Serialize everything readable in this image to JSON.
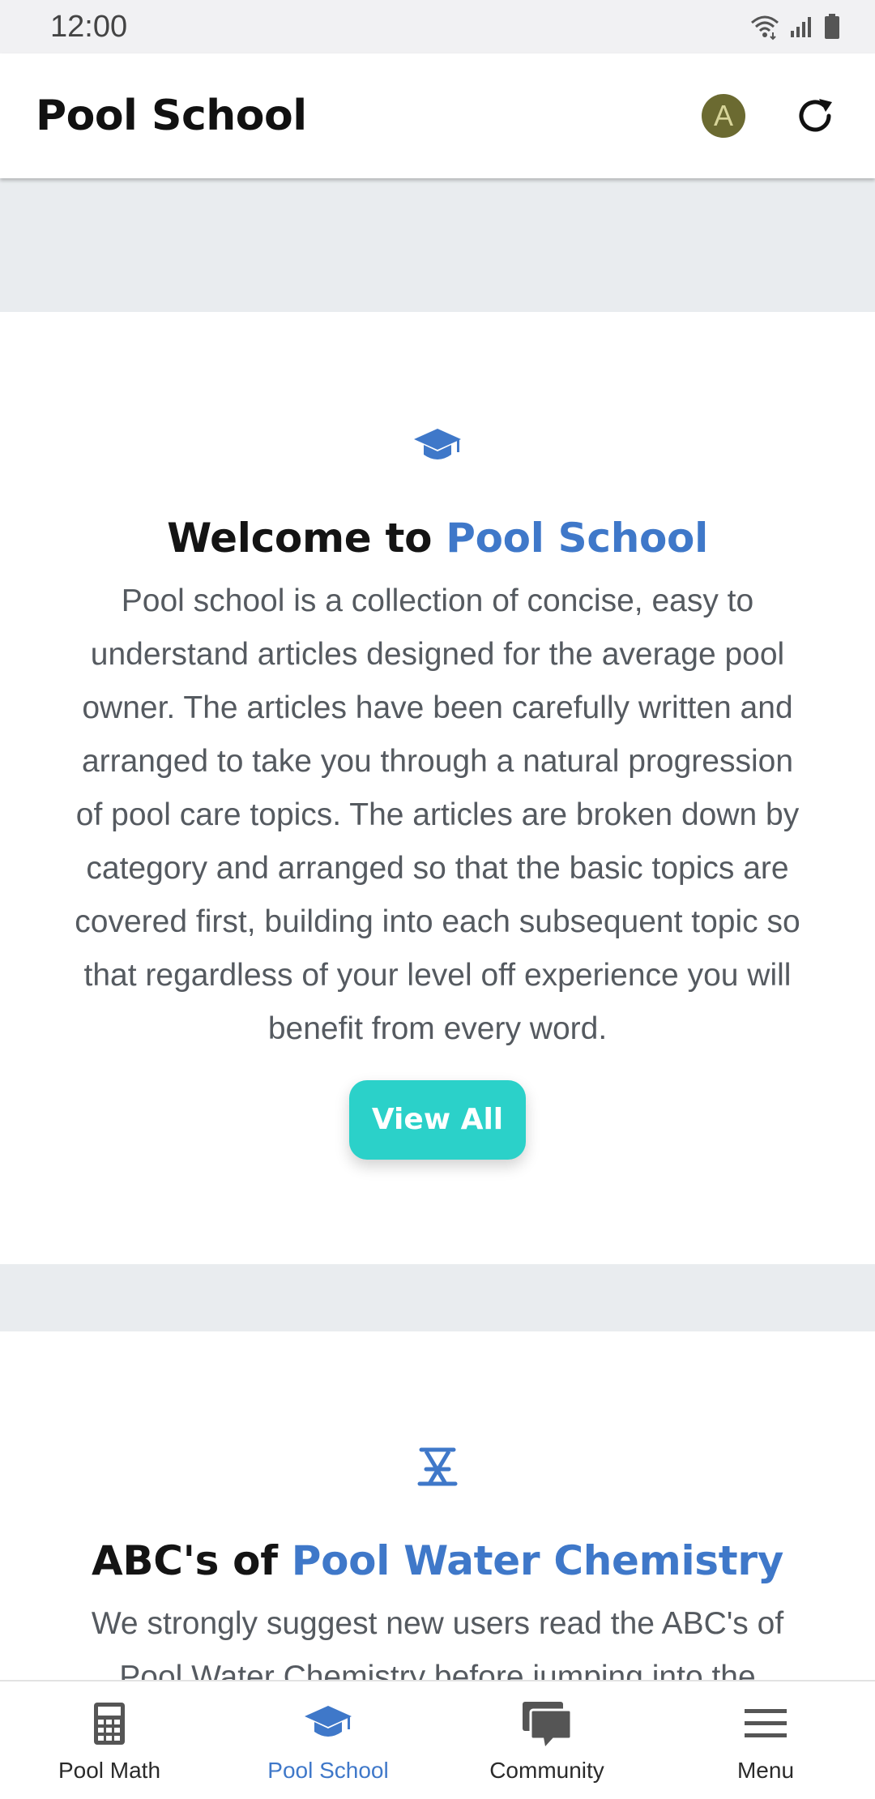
{
  "status_bar": {
    "time": "12:00"
  },
  "app_bar": {
    "title": "Pool School",
    "avatar_initial": "A"
  },
  "cards": [
    {
      "icon": "graduation-cap-icon",
      "heading_prefix": "Welcome to ",
      "heading_accent": "Pool School",
      "body": "Pool school is a collection of concise, easy to understand articles designed for the average pool owner. The articles have been carefully written and arranged to take you through a natural progression of pool care topics. The articles are broken down by category and arranged so that the basic topics are covered first, building into each subsequent topic so that regardless of your level off experience you will benefit from every word.",
      "button_label": "View All"
    },
    {
      "icon": "flask-icon",
      "heading_prefix": "ABC's of ",
      "heading_accent": "Pool Water Chemistry",
      "body": "We strongly suggest new users read the ABC's of Pool Water Chemistry before jumping into the"
    }
  ],
  "bottom_nav": {
    "items": [
      {
        "label": "Pool Math",
        "icon": "calculator-icon",
        "active": false
      },
      {
        "label": "Pool School",
        "icon": "graduation-cap-icon",
        "active": true
      },
      {
        "label": "Community",
        "icon": "chat-bubbles-icon",
        "active": false
      },
      {
        "label": "Menu",
        "icon": "hamburger-menu-icon",
        "active": false
      }
    ]
  },
  "colors": {
    "accent": "#3f78c9",
    "button": "#2bd1c9",
    "avatar": "#6b6a31",
    "background": "#e9ecef"
  }
}
